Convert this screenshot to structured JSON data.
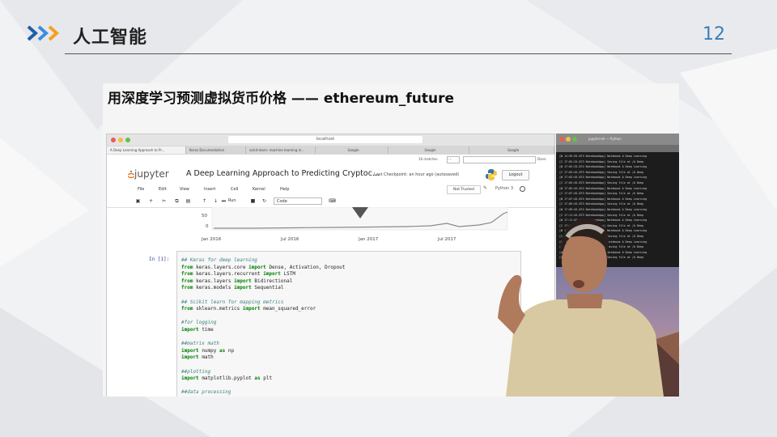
{
  "slide": {
    "title": "人工智能",
    "page_number": "12",
    "caption": "用深度学习预测虚拟货币价格 —— ethereum_future",
    "accent_colors": [
      "#1f5fa8",
      "#3d8de0",
      "#f4a020"
    ]
  },
  "browser": {
    "url": "localhost",
    "tabs": [
      "A Deep Learning Approach to Pr...",
      "Keras Documentation",
      "scikit-learn: machine learning in...",
      "Google",
      "Google",
      "Google"
    ],
    "find_status": "16 matches",
    "find_done": "Done"
  },
  "jupyter": {
    "logo_text": "jupyter",
    "notebook_title": "A Deep Learning Approach to Predicting Cryptoc...",
    "checkpoint": "Last Checkpoint: an hour ago",
    "autosaved": "(autosaved)",
    "logout_label": "Logout",
    "menu": [
      "File",
      "Edit",
      "View",
      "Insert",
      "Cell",
      "Kernel",
      "Help"
    ],
    "trust_status": "Not Trusted",
    "kernel_name": "Python 3",
    "run_label": "Run",
    "cell_type": "Code",
    "toolbar_icons": [
      "save-icon",
      "plus-icon",
      "cut-icon",
      "copy-icon",
      "paste-icon",
      "arrow-up-icon",
      "arrow-down-icon",
      "run-icon",
      "stop-icon",
      "restart-icon",
      "keyboard-icon"
    ]
  },
  "plot": {
    "y_ticks": [
      "50",
      "0"
    ],
    "x_ticks": [
      "Jan 2016",
      "Jul 2016",
      "Jan 2017",
      "Jul 2017"
    ]
  },
  "code_cell": {
    "prompt": "In [1]:",
    "lines": [
      {
        "type": "comment",
        "text": "## Keras for deep learning"
      },
      {
        "type": "import",
        "text": "from keras.layers.core import Dense, Activation, Dropout"
      },
      {
        "type": "import",
        "text": "from keras.layers.recurrent import LSTM"
      },
      {
        "type": "import",
        "text": "from keras.layers import Bidirectional"
      },
      {
        "type": "import",
        "text": "from keras.models import Sequential"
      },
      {
        "type": "blank",
        "text": ""
      },
      {
        "type": "comment",
        "text": "## Scikit learn for mapping metrics"
      },
      {
        "type": "import",
        "text": "from sklearn.metrics import mean_squared_error"
      },
      {
        "type": "blank",
        "text": ""
      },
      {
        "type": "comment",
        "text": "#for logging"
      },
      {
        "type": "import",
        "text": "import time"
      },
      {
        "type": "blank",
        "text": ""
      },
      {
        "type": "comment",
        "text": "##matrix math"
      },
      {
        "type": "import",
        "text": "import numpy as np"
      },
      {
        "type": "import",
        "text": "import math"
      },
      {
        "type": "blank",
        "text": ""
      },
      {
        "type": "comment",
        "text": "##plotting"
      },
      {
        "type": "import",
        "text": "import matplotlib.pyplot as plt"
      },
      {
        "type": "blank",
        "text": ""
      },
      {
        "type": "comment",
        "text": "##data processing"
      }
    ]
  },
  "terminal": {
    "title": "jupyter-ml — Python",
    "lines": [
      "[W 14:59:55.873 NotebookApp] Notebook A Deep Learning",
      "[I 17:02:25.873 NotebookApp] Saving file at /A Deep",
      "[W 17:02:25.874 NotebookApp] Notebook A Deep Learning",
      "[I 17:03:45.873 NotebookApp] Saving file at /A Deep",
      "[W 17:03:45.874 NotebookApp] Notebook A Deep Learning",
      "[I 17:05:45.873 NotebookApp] Saving file at /A Deep",
      "[W 17:05:45.874 NotebookApp] Notebook A Deep Learning",
      "[I 17:07:45.873 NotebookApp] Saving file at /A Deep",
      "[W 17:07:45.874 NotebookApp] Notebook A Deep Learning",
      "[I 17:09:45.873 NotebookApp] Saving file at /A Deep",
      "[W 17:09:45.874 NotebookApp] Notebook A Deep Learning",
      "[I 17:11:45.873 NotebookApp] Saving file at /A Deep",
      "[W 17:11:45.874 NotebookApp] Notebook A Deep Learning",
      "[I 17:13:45.873 NotebookApp] Saving file at /A Deep",
      "[W 17:13:45.874 NotebookApp] Notebook A Deep Learning",
      "[I 17:15:45.873 NotebookApp] Saving file at /A Deep",
      "[W 17:15:45.874 NotebookApp] Notebook A Deep Learning",
      "[I 17:17:45.873 NotebookApp] Saving file at /A Deep",
      "[W 17:17:45.874 NotebookApp] Notebook A Deep Learning",
      "[I 17:19:45.873 NotebookApp] Saving file at /A Deep"
    ]
  }
}
